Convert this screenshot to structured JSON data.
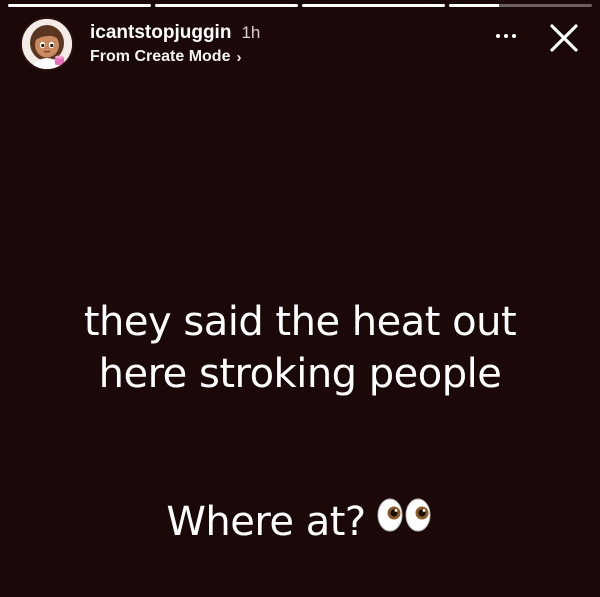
{
  "story": {
    "progress": [
      1,
      1,
      1,
      0.35
    ],
    "user": {
      "username": "icantstopjuggin",
      "time": "1h",
      "subtitle": "From Create Mode",
      "subtitle_chevron": "›",
      "avatar_icon": "cartoon-girl-avatar"
    },
    "controls": {
      "more_icon": "ellipsis-icon",
      "close_icon": "close-icon"
    },
    "caption": {
      "line1": "they said the heat out",
      "line2": "here stroking people",
      "question": "Where at?",
      "emoji_icon": "eyes-emoji"
    },
    "colors": {
      "background": "#1b0808",
      "text": "#ffffff"
    }
  }
}
